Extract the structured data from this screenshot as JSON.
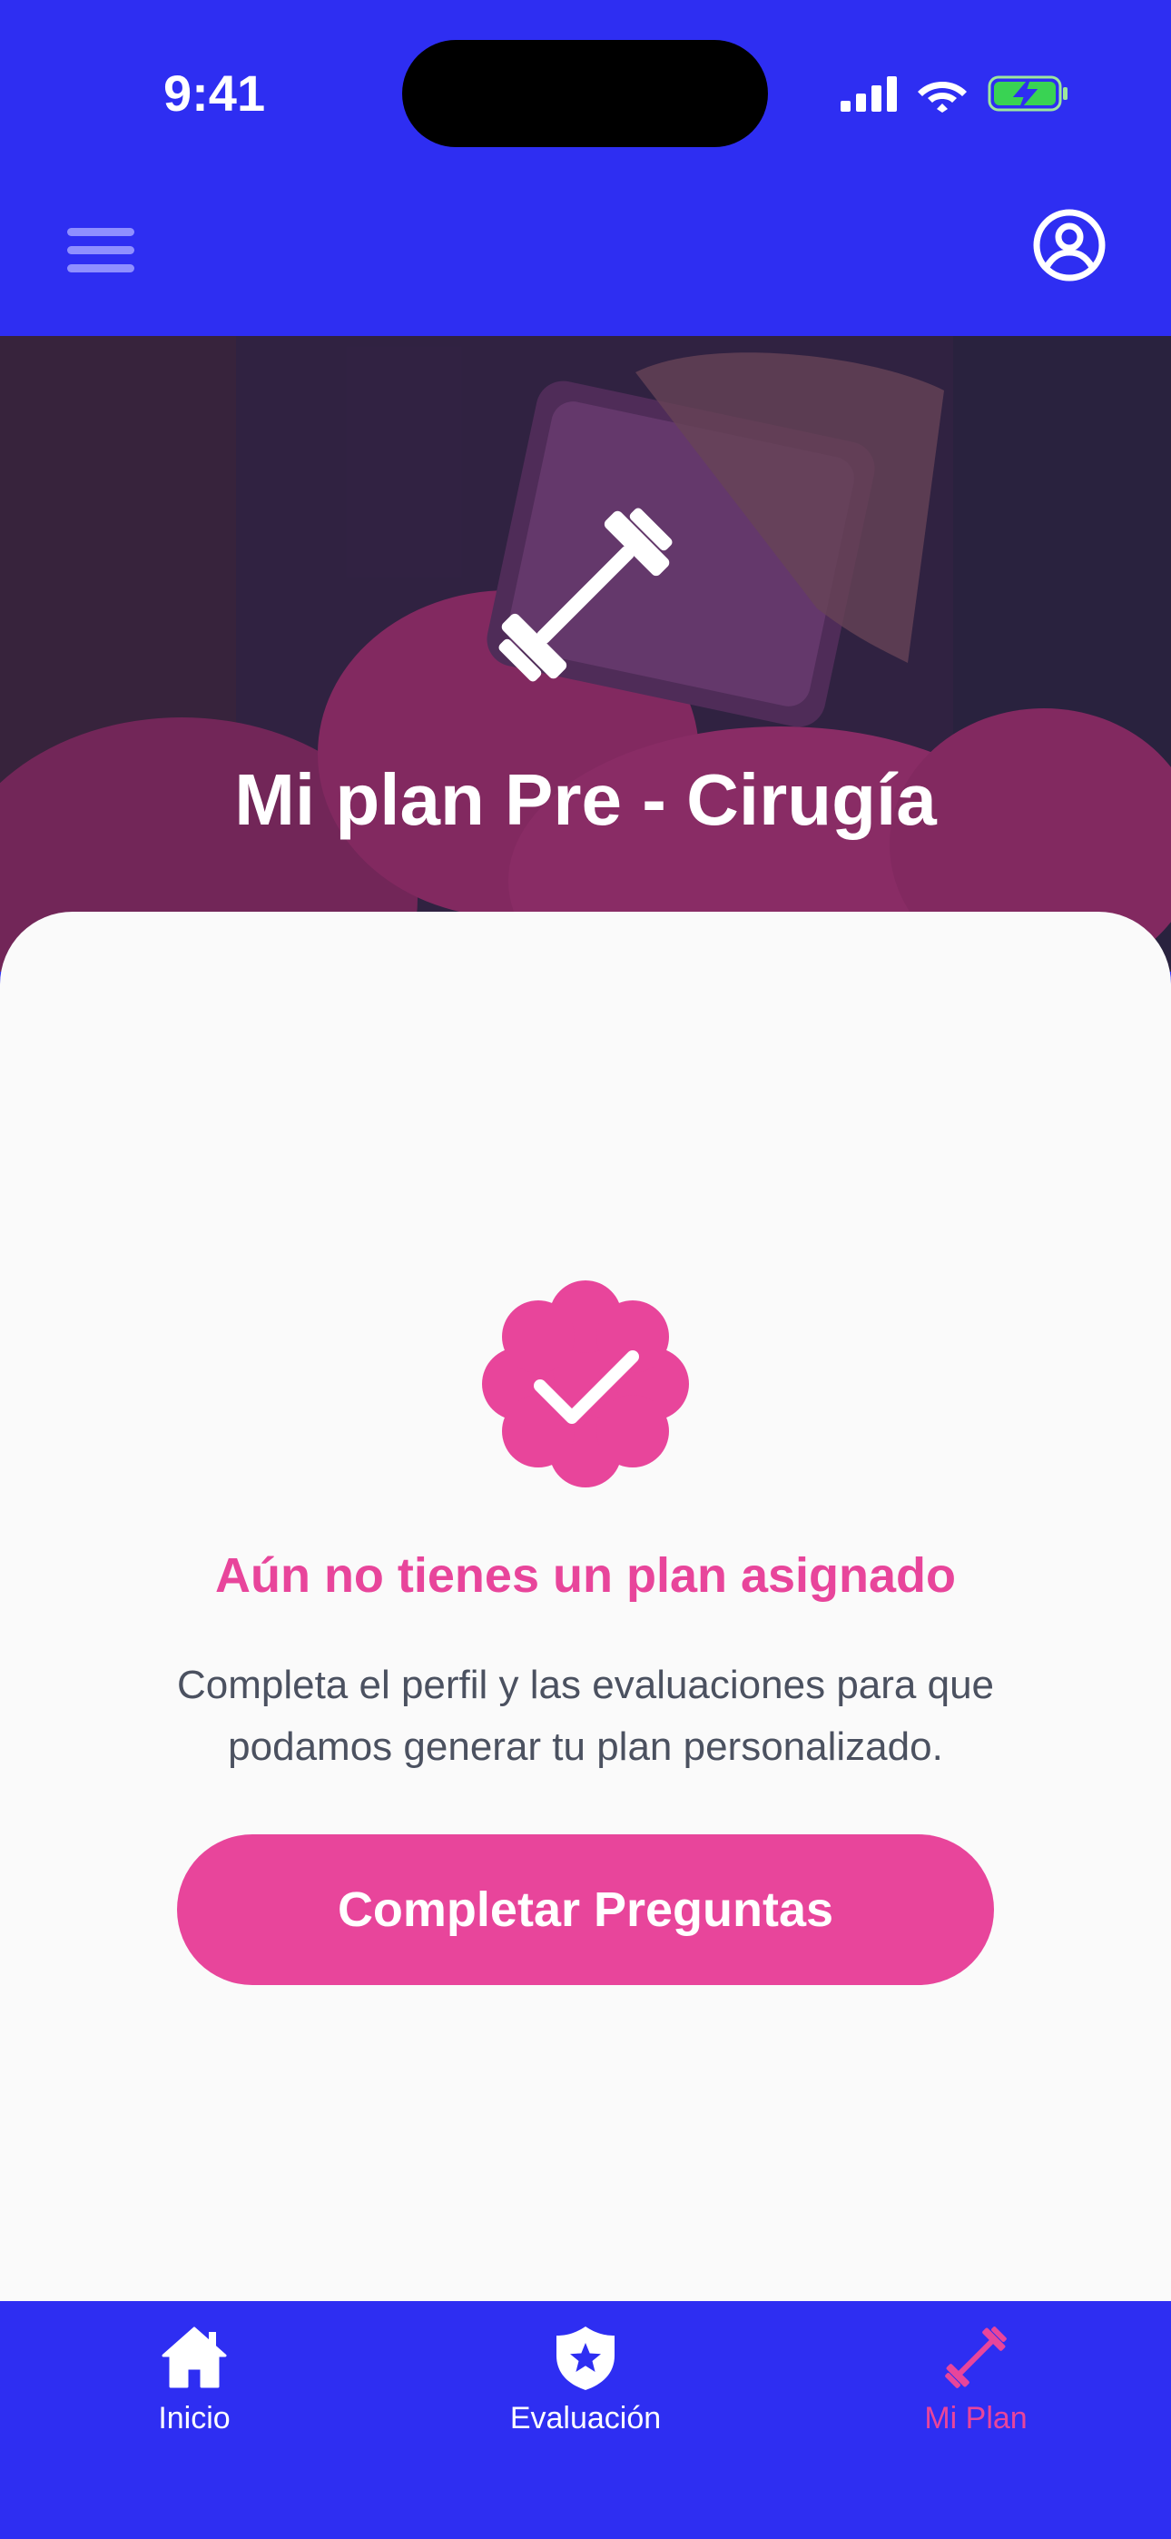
{
  "status_bar": {
    "time": "9:41"
  },
  "header": {
    "menu_icon": "hamburger-menu-icon",
    "profile_icon": "user-circle-icon"
  },
  "hero": {
    "icon": "dumbbell-icon",
    "title": "Mi plan Pre - Cirugía"
  },
  "empty_state": {
    "icon": "verified-check-badge-icon",
    "title": "Aún no tienes un plan asignado",
    "description": "Completa el perfil y las evaluaciones para que podamos generar tu plan personalizado.",
    "button_label": "Completar Preguntas"
  },
  "tab_bar": {
    "items": [
      {
        "label": "Inicio",
        "icon": "home-icon",
        "active": false
      },
      {
        "label": "Evaluación",
        "icon": "shield-star-icon",
        "active": false
      },
      {
        "label": "Mi Plan",
        "icon": "dumbbell-icon",
        "active": true
      }
    ]
  },
  "colors": {
    "primary_blue": "#2E2EF2",
    "accent_pink": "#E8459B",
    "card_background": "#FAFAFA",
    "text_gray": "#4B5160"
  }
}
